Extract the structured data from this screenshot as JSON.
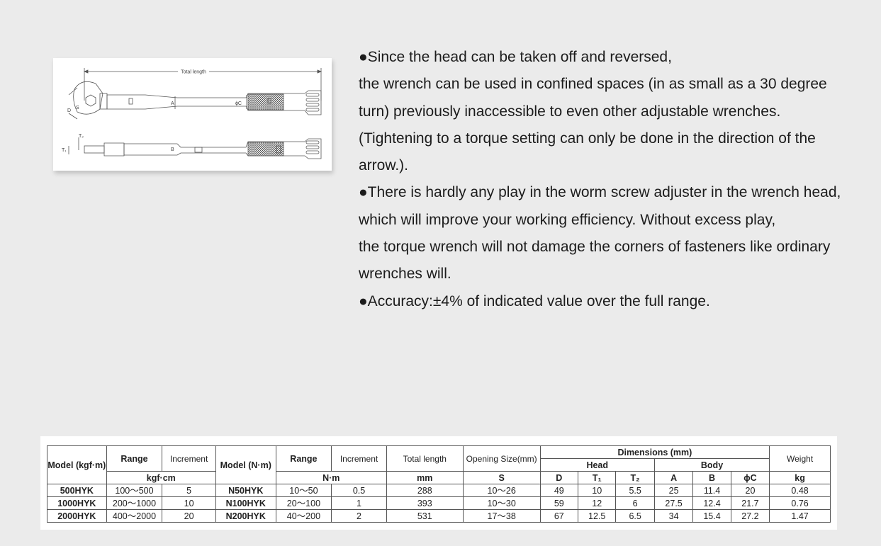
{
  "diagram": {
    "labels": {
      "total_length": "Total length",
      "d": "D",
      "s": "S",
      "a": "A",
      "phi_c": "ϕC",
      "b": "B",
      "t1": "T₁",
      "t2": "T₂"
    }
  },
  "description": {
    "paragraphs": [
      "●Since the head can be taken off and reversed,",
      " the wrench can be used in confined spaces (in as small as a 30 degree turn) previously inaccessible to even other adjustable wrenches.",
      " (Tightening to a torque setting can only be done in the direction of the arrow.).",
      "●There is hardly any play in the worm screw adjuster in the wrench head, which will improve your working efficiency. Without excess play,",
      " the torque wrench will not damage the corners of fasteners like ordinary wrenches will.",
      "●Accuracy:±4% of indicated value over the full range."
    ]
  },
  "table": {
    "headers": {
      "model_kgf": "Model (kgf·m)",
      "range": "Range",
      "increment": "Increment",
      "model_nm": "Model (N·m)",
      "total_length": "Total length",
      "opening_size": "Opening Size(mm)",
      "dimensions": "Dimensions (mm)",
      "head": "Head",
      "body": "Body",
      "weight": "Weight"
    },
    "units": {
      "kgf_cm": "kgf·cm",
      "nm": "N·m",
      "mm": "mm",
      "s": "S",
      "d": "D",
      "t1": "T₁",
      "t2": "T₂",
      "a": "A",
      "b": "B",
      "phi_c": "ϕC",
      "kg": "kg"
    },
    "rows": [
      {
        "model_kgf": "500HYK",
        "range_kgf": "100～500",
        "inc_kgf": "5",
        "model_nm": "N50HYK",
        "range_nm": "10～50",
        "inc_nm": "0.5",
        "total_length": "288",
        "s": "10～26",
        "d": "49",
        "t1": "10",
        "t2": "5.5",
        "a": "25",
        "b": "11.4",
        "c": "20",
        "weight": "0.48"
      },
      {
        "model_kgf": "1000HYK",
        "range_kgf": "200～1000",
        "inc_kgf": "10",
        "model_nm": "N100HYK",
        "range_nm": "20～100",
        "inc_nm": "1",
        "total_length": "393",
        "s": "10～30",
        "d": "59",
        "t1": "12",
        "t2": "6",
        "a": "27.5",
        "b": "12.4",
        "c": "21.7",
        "weight": "0.76"
      },
      {
        "model_kgf": "2000HYK",
        "range_kgf": "400～2000",
        "inc_kgf": "20",
        "model_nm": "N200HYK",
        "range_nm": "40～200",
        "inc_nm": "2",
        "total_length": "531",
        "s": "17～38",
        "d": "67",
        "t1": "12.5",
        "t2": "6.5",
        "a": "34",
        "b": "15.4",
        "c": "27.2",
        "weight": "1.47"
      }
    ]
  }
}
